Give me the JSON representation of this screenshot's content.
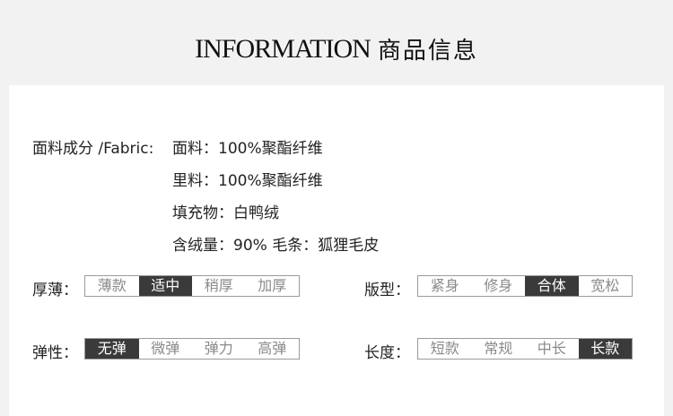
{
  "header": {
    "title": "INFORMATION",
    "subtitle": "商品信息"
  },
  "fabric": {
    "label": "面料成分 /Fabric:",
    "lines": [
      "面料：100%聚酯纤维",
      "里料：100%聚酯纤维",
      "填充物：白鸭绒",
      "含绒量：90% 毛条：狐狸毛皮"
    ]
  },
  "thickness": {
    "label": "厚薄：",
    "options": [
      "薄款",
      "适中",
      "稍厚",
      "加厚"
    ],
    "selected": 1
  },
  "fit": {
    "label": "版型：",
    "options": [
      "紧身",
      "修身",
      "合体",
      "宽松"
    ],
    "selected": 2
  },
  "elasticity": {
    "label": "弹性：",
    "options": [
      "无弹",
      "微弹",
      "弹力",
      "高弹"
    ],
    "selected": 0
  },
  "length": {
    "label": "长度：",
    "options": [
      "短款",
      "常规",
      "中长",
      "长款"
    ],
    "selected": 3
  },
  "colors": {
    "selected_bg": "#3a3a3a",
    "border": "#9a9a9a",
    "inactive_text": "#8a8a8a",
    "page_bg": "#f2f2f2"
  }
}
